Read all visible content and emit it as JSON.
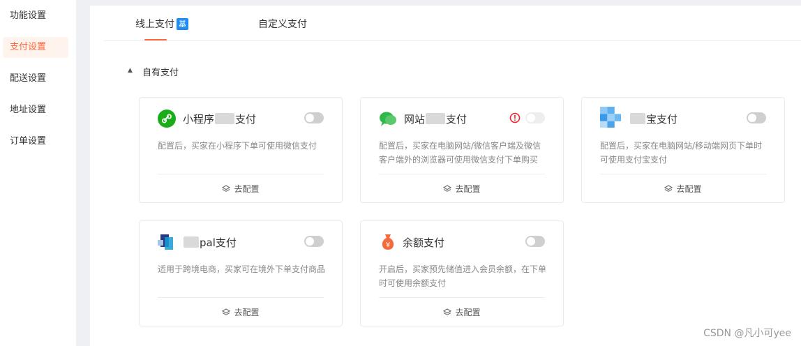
{
  "sidebar": {
    "items": [
      {
        "label": "功能设置"
      },
      {
        "label": "支付设置"
      },
      {
        "label": "配送设置"
      },
      {
        "label": "地址设置"
      },
      {
        "label": "订单设置"
      }
    ]
  },
  "tabs": [
    {
      "label": "线上支付",
      "badge": "基"
    },
    {
      "label": "自定义支付"
    }
  ],
  "section": {
    "toggle_glyph": "▲",
    "title": "自有支付"
  },
  "cards": [
    {
      "title_pre": "小程序",
      "title_post": "支付",
      "desc": "配置后，买家在小程序下单可使用微信支付",
      "config": "去配置",
      "enabled": false,
      "icon_color": "#1aad19"
    },
    {
      "title_pre": "网站",
      "title_post": "支付",
      "desc": "配置后，买家在电脑网站/微信客户端及微信客户端外的浏览器可使用微信支付下单购买",
      "config": "去配置",
      "enabled": false,
      "icon_color": "#2fb94a",
      "warn_color": "#f5222d"
    },
    {
      "title_pre": "",
      "title_post": "宝支付",
      "desc": "配置后，买家在电脑网站/移动端网页下单时可使用支付宝支付",
      "config": "去配置",
      "enabled": false,
      "icon_color": "#1677ff"
    },
    {
      "title_pre": "",
      "title_post": "pal支付",
      "desc": "适用于跨境电商，买家可在境外下单支付商品",
      "config": "去配置",
      "enabled": false,
      "icon_color": "#253b80"
    },
    {
      "title_pre": "",
      "title_post": "余额支付",
      "desc": "开启后，买家预先储值进入会员余额，在下单时可使用余额支付",
      "config": "去配置",
      "enabled": false,
      "icon_color": "#f36a3d",
      "icon_glyph": "¥"
    }
  ],
  "watermark": "CSDN @凡小可yee",
  "colors": {
    "accent": "#ff6a3d",
    "badge": "#1d8df5"
  }
}
